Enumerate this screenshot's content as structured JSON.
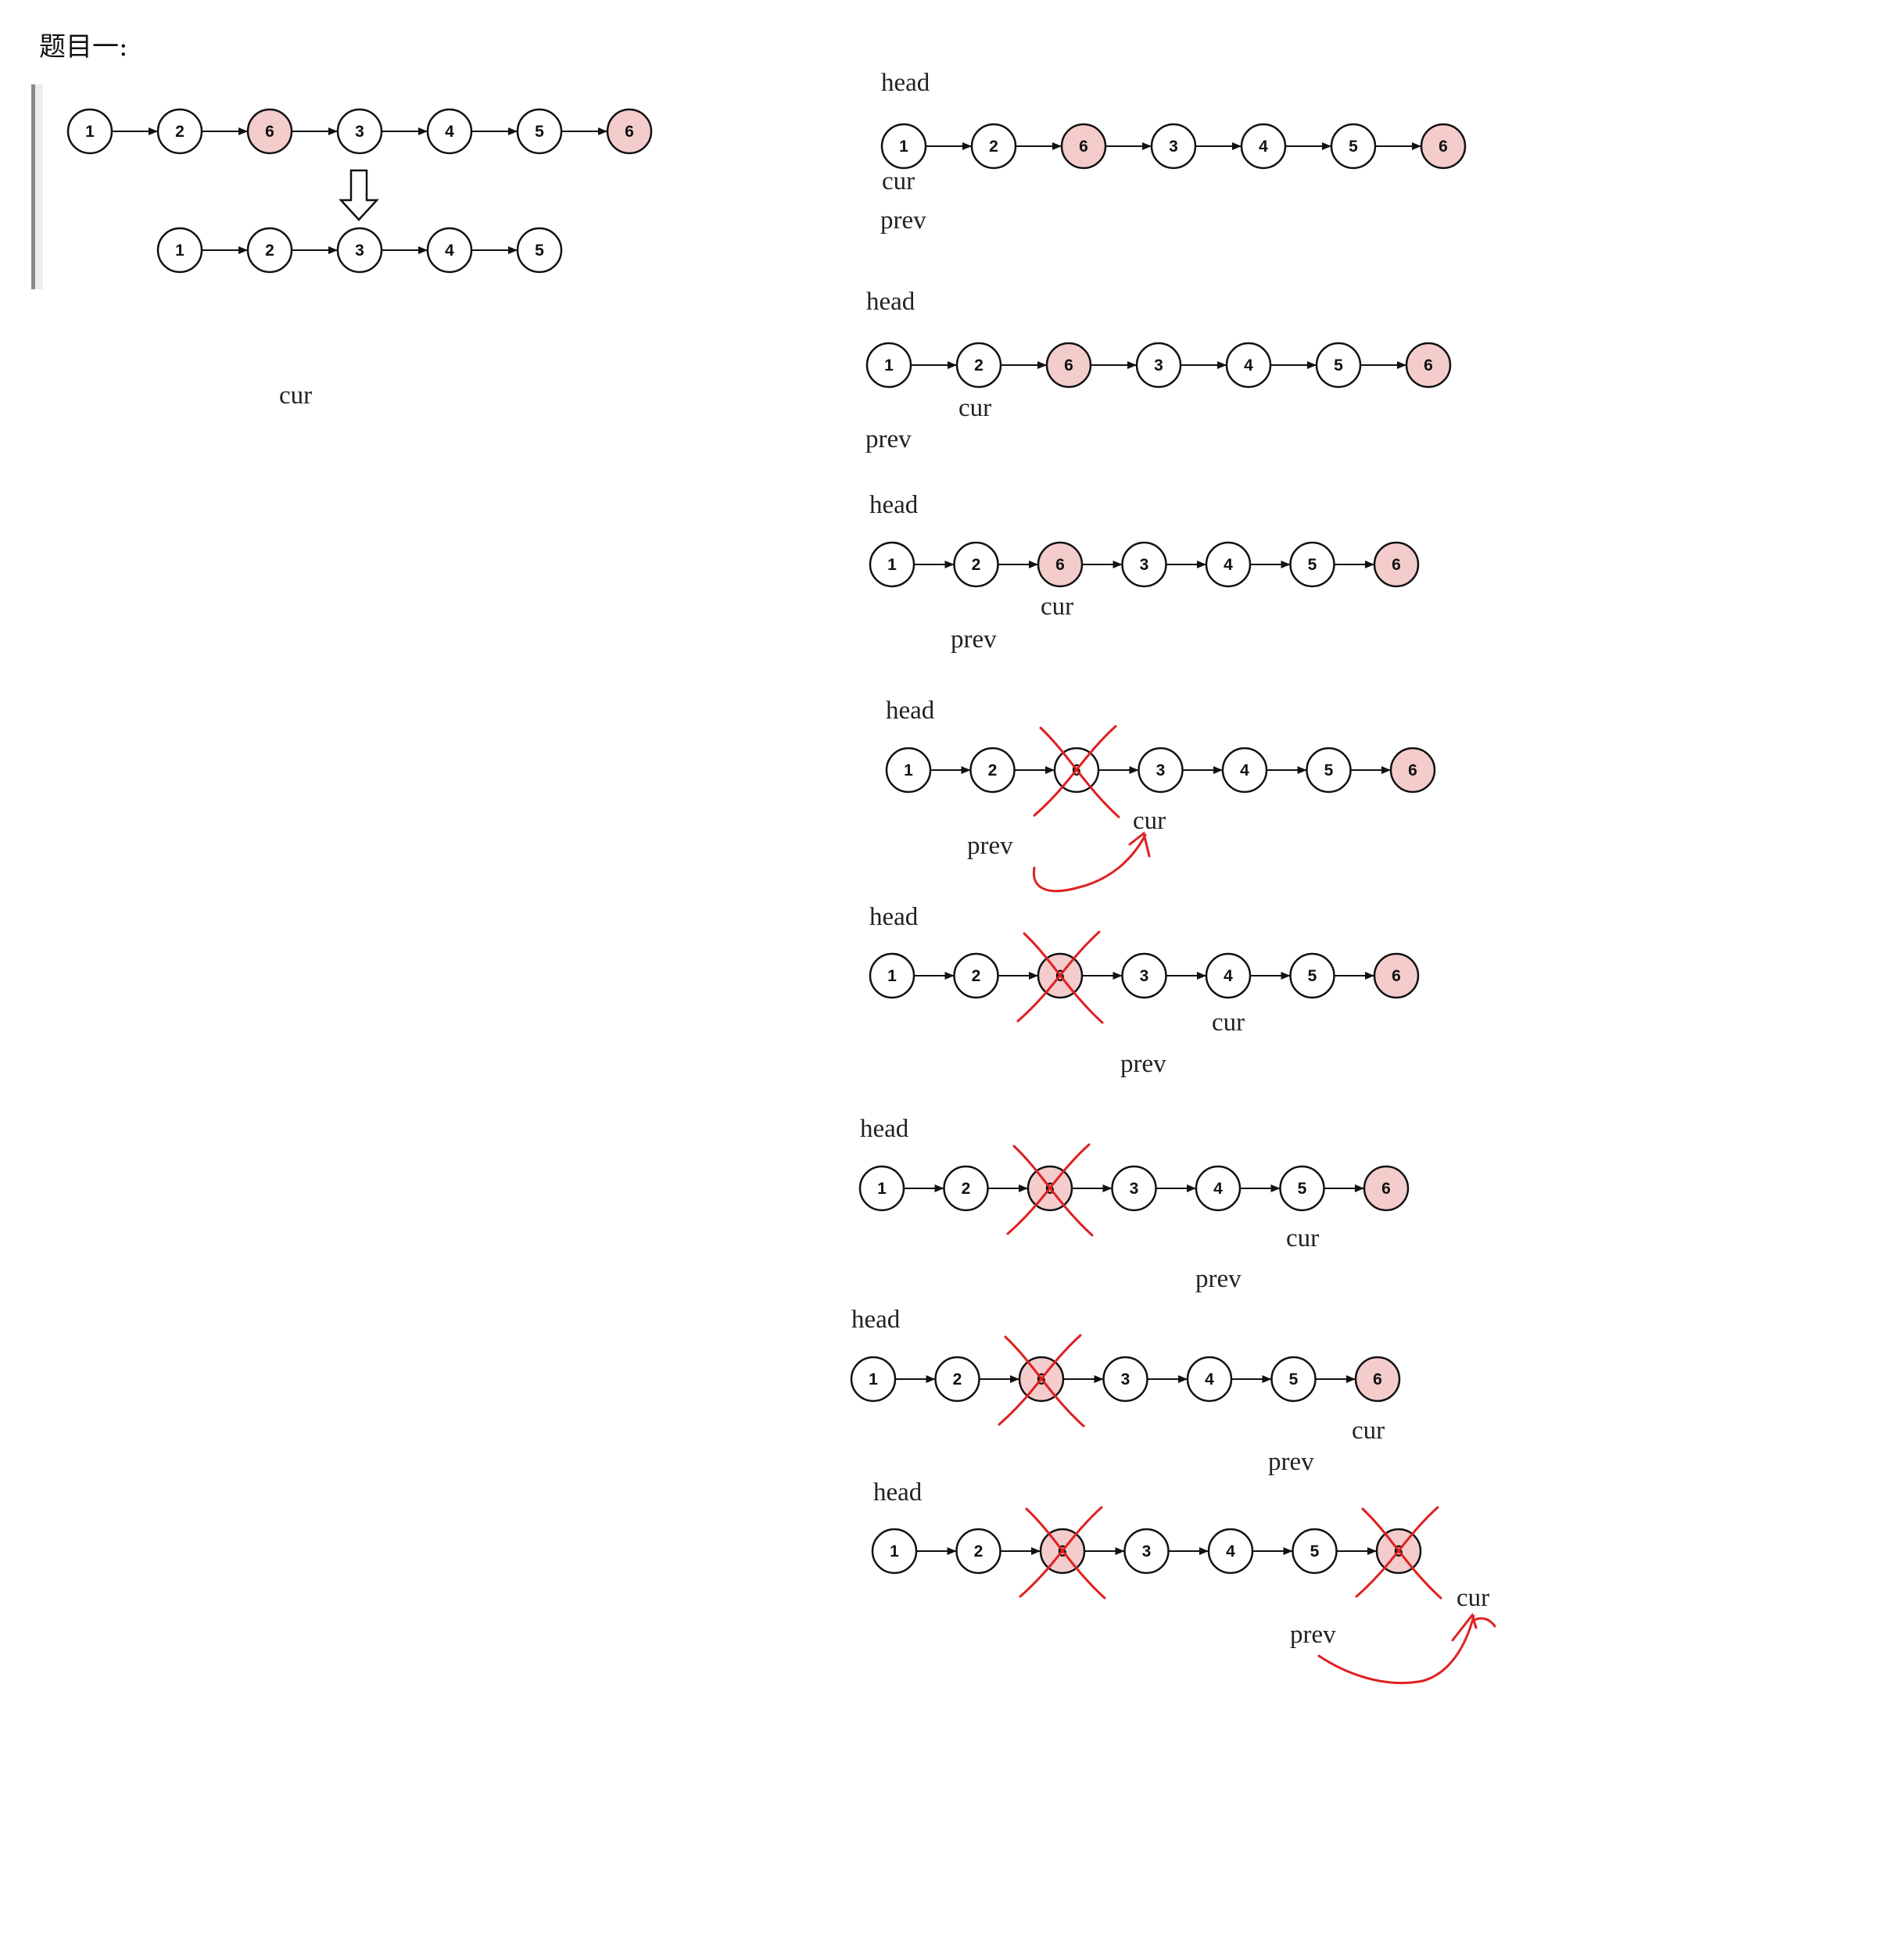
{
  "title": "题目一:",
  "colors": {
    "removed_fill": "#f4cccc",
    "normal_fill": "#ffffff",
    "stroke": "#111111",
    "strike": "#e02020"
  },
  "example": {
    "input": [
      "1",
      "2",
      "6",
      "3",
      "4",
      "5",
      "6"
    ],
    "output": [
      "1",
      "2",
      "3",
      "4",
      "5"
    ],
    "highlighted": [
      2,
      6
    ],
    "caption": "cur"
  },
  "steps": [
    {
      "values": [
        "1",
        "2",
        "6",
        "3",
        "4",
        "5",
        "6"
      ],
      "highlighted": [
        2,
        6
      ],
      "crossed": [],
      "labels": {
        "head": "head",
        "cur": "cur",
        "prev": "prev"
      }
    },
    {
      "values": [
        "1",
        "2",
        "6",
        "3",
        "4",
        "5",
        "6"
      ],
      "highlighted": [
        2,
        6
      ],
      "crossed": [],
      "labels": {
        "head": "head",
        "cur": "cur",
        "prev": "prev"
      }
    },
    {
      "values": [
        "1",
        "2",
        "6",
        "3",
        "4",
        "5",
        "6"
      ],
      "highlighted": [
        2,
        6
      ],
      "crossed": [],
      "labels": {
        "head": "head",
        "cur": "cur",
        "prev": "prev"
      }
    },
    {
      "values": [
        "1",
        "2",
        "6",
        "3",
        "4",
        "5",
        "6"
      ],
      "highlighted": [
        6
      ],
      "crossed": [
        2
      ],
      "labels": {
        "head": "head",
        "cur": "cur",
        "prev": "prev"
      }
    },
    {
      "values": [
        "1",
        "2",
        "6",
        "3",
        "4",
        "5",
        "6"
      ],
      "highlighted": [
        2,
        6
      ],
      "crossed": [
        2
      ],
      "labels": {
        "head": "head",
        "cur": "cur",
        "prev": "prev"
      }
    },
    {
      "values": [
        "1",
        "2",
        "6",
        "3",
        "4",
        "5",
        "6"
      ],
      "highlighted": [
        2,
        6
      ],
      "crossed": [
        2
      ],
      "labels": {
        "head": "head",
        "cur": "cur",
        "prev": "prev"
      }
    },
    {
      "values": [
        "1",
        "2",
        "6",
        "3",
        "4",
        "5",
        "6"
      ],
      "highlighted": [
        2,
        6
      ],
      "crossed": [
        2
      ],
      "labels": {
        "head": "head",
        "cur": "cur",
        "prev": "prev"
      }
    },
    {
      "values": [
        "1",
        "2",
        "6",
        "3",
        "4",
        "5",
        "6"
      ],
      "highlighted": [
        2,
        6
      ],
      "crossed": [
        2,
        6
      ],
      "labels": {
        "head": "head",
        "cur": "cur",
        "prev": "prev"
      }
    }
  ]
}
